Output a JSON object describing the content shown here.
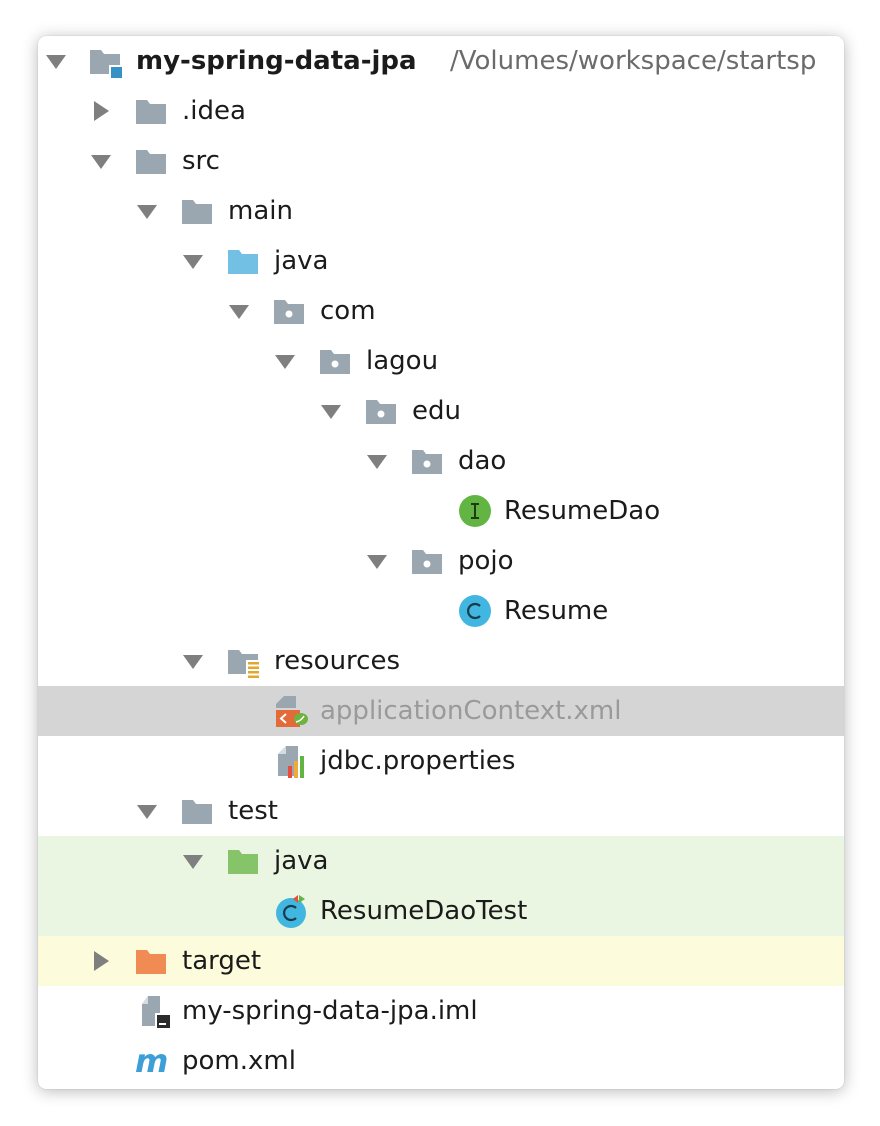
{
  "project": {
    "name": "my-spring-data-jpa",
    "path": "/Volumes/workspace/startsp"
  },
  "tree": {
    "idea": ".idea",
    "src": "src",
    "main": "main",
    "main_java": "java",
    "com": "com",
    "lagou": "lagou",
    "edu": "edu",
    "dao": "dao",
    "resume_dao": "ResumeDao",
    "pojo": "pojo",
    "resume": "Resume",
    "resources": "resources",
    "application_context": "applicationContext.xml",
    "jdbc_properties": "jdbc.properties",
    "test": "test",
    "test_java": "java",
    "resume_dao_test": "ResumeDaoTest",
    "target": "target",
    "iml": "my-spring-data-jpa.iml",
    "pom": "pom.xml"
  },
  "icons": {
    "module": "module-folder-icon",
    "folder": "folder-icon",
    "source_root": "source-root-folder-icon",
    "package": "package-icon",
    "interface": "interface-icon",
    "class": "class-icon",
    "resources_root": "resources-root-icon",
    "spring_xml": "spring-xml-file-icon",
    "properties": "properties-file-icon",
    "test_root": "test-root-folder-icon",
    "test_class": "test-class-icon",
    "excluded": "excluded-folder-icon",
    "iml": "iml-file-icon",
    "maven": "maven-pom-icon"
  },
  "colors": {
    "folder_gray": "#9aa7b0",
    "source_blue": "#72c1e5",
    "test_green": "#86c46a",
    "excluded_orange": "#f08b54",
    "interface_green": "#62b543",
    "class_blue": "#40b6e0",
    "selection": "#d5d5d5",
    "test_bg": "#eaf6e1",
    "excluded_bg": "#fcfbdc"
  }
}
